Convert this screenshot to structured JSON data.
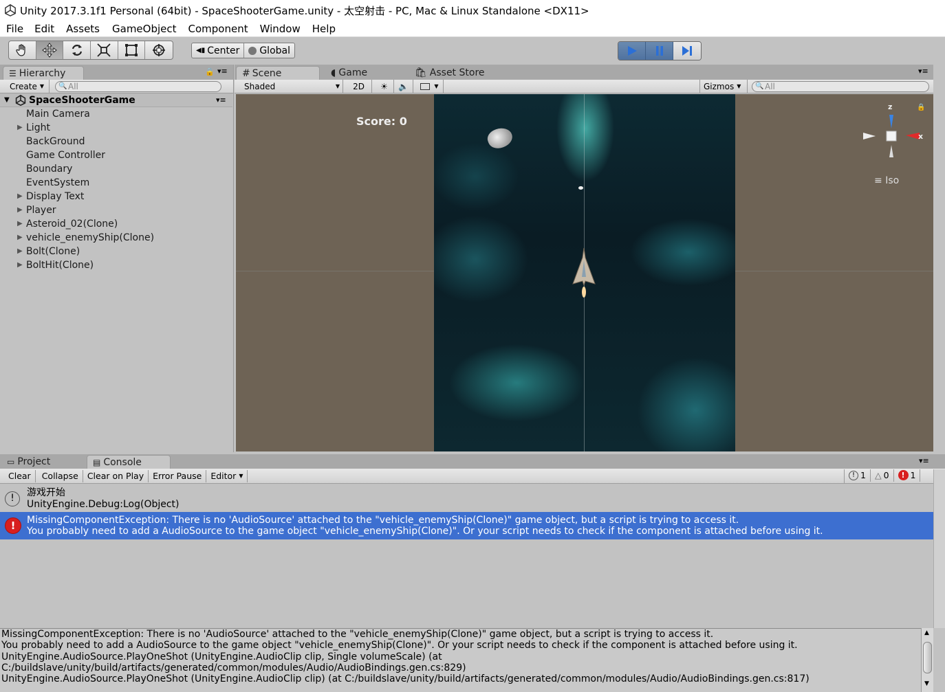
{
  "window": {
    "title": "Unity 2017.3.1f1 Personal (64bit) - SpaceShooterGame.unity - 太空射击 - PC, Mac & Linux Standalone <DX11>"
  },
  "menu": [
    "File",
    "Edit",
    "Assets",
    "GameObject",
    "Component",
    "Window",
    "Help"
  ],
  "toolbar": {
    "pivot": "Center",
    "space": "Global"
  },
  "hierarchy": {
    "tab": "Hierarchy",
    "create": "Create",
    "search_placeholder": "All",
    "root": "SpaceShooterGame",
    "items": [
      {
        "label": "Main Camera",
        "arrow": ""
      },
      {
        "label": "Light",
        "arrow": "▶"
      },
      {
        "label": "BackGround",
        "arrow": ""
      },
      {
        "label": "Game Controller",
        "arrow": ""
      },
      {
        "label": "Boundary",
        "arrow": ""
      },
      {
        "label": "EventSystem",
        "arrow": ""
      },
      {
        "label": "Display Text",
        "arrow": "▶"
      },
      {
        "label": "Player",
        "arrow": "▶"
      },
      {
        "label": "Asteroid_02(Clone)",
        "arrow": "▶"
      },
      {
        "label": "vehicle_enemyShip(Clone)",
        "arrow": "▶"
      },
      {
        "label": "Bolt(Clone)",
        "arrow": "▶"
      },
      {
        "label": "BoltHit(Clone)",
        "arrow": "▶"
      }
    ]
  },
  "scene": {
    "tabs": [
      "Scene",
      "Game",
      "Asset Store"
    ],
    "shading": "Shaded",
    "mode2d": "2D",
    "gizmos": "Gizmos",
    "search_placeholder": "All",
    "score": "Score: 0",
    "iso": "Iso",
    "axis_z": "z",
    "axis_x": "x"
  },
  "bottom": {
    "tabs": [
      "Project",
      "Console"
    ],
    "buttons": [
      "Clear",
      "Collapse",
      "Clear on Play",
      "Error Pause",
      "Editor"
    ],
    "counts": {
      "info": "1",
      "warn": "0",
      "error": "1"
    },
    "logs": [
      {
        "line1": "游戏开始",
        "line2": "UnityEngine.Debug:Log(Object)"
      },
      {
        "line1": "MissingComponentException: There is no 'AudioSource' attached to the \"vehicle_enemyShip(Clone)\" game object, but a script is trying to access it.",
        "line2": "You probably need to add a AudioSource to the game object \"vehicle_enemyShip(Clone)\". Or your script needs to check if the component is attached before using it."
      }
    ],
    "detail": [
      "MissingComponentException: There is no 'AudioSource' attached to the \"vehicle_enemyShip(Clone)\" game object, but a script is trying to access it.",
      "You probably need to add a AudioSource to the game object \"vehicle_enemyShip(Clone)\". Or your script needs to check if the component is attached before using it.",
      "UnityEngine.AudioSource.PlayOneShot (UnityEngine.AudioClip clip, Single volumeScale) (at",
      "C:/buildslave/unity/build/artifacts/generated/common/modules/Audio/AudioBindings.gen.cs:829)",
      "UnityEngine.AudioSource.PlayOneShot (UnityEngine.AudioClip clip) (at C:/buildslave/unity/build/artifacts/generated/common/modules/Audio/AudioBindings.gen.cs:817)"
    ]
  }
}
